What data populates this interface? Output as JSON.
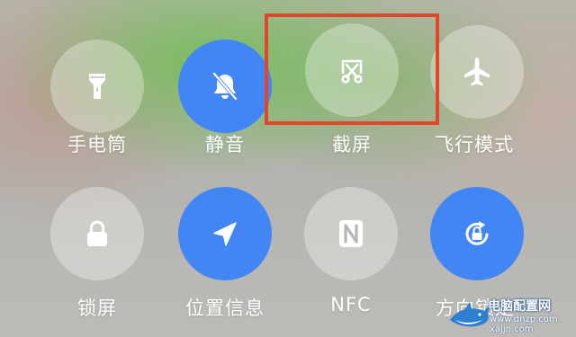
{
  "quick_settings": {
    "tiles": [
      {
        "label": "手电筒",
        "icon": "flashlight-icon",
        "active": false
      },
      {
        "label": "静音",
        "icon": "bell-mute-icon",
        "active": true
      },
      {
        "label": "截屏",
        "icon": "screenshot-icon",
        "active": false
      },
      {
        "label": "飞行模式",
        "icon": "airplane-icon",
        "active": false
      },
      {
        "label": "锁屏",
        "icon": "lock-icon",
        "active": false
      },
      {
        "label": "位置信息",
        "icon": "location-icon",
        "active": true
      },
      {
        "label": "NFC",
        "icon": "nfc-icon",
        "active": false
      },
      {
        "label": "方向锁定",
        "icon": "rotation-lock-icon",
        "active": true
      }
    ]
  },
  "annotation": {
    "color": "#e2452b"
  },
  "colors": {
    "active_tile": "#4186f4",
    "inactive_tile": "rgba(255,255,255,0.32)"
  },
  "watermark": {
    "title": "电脑配置网",
    "url1": "www.dnzp.com",
    "url2": "xajjn.com"
  }
}
